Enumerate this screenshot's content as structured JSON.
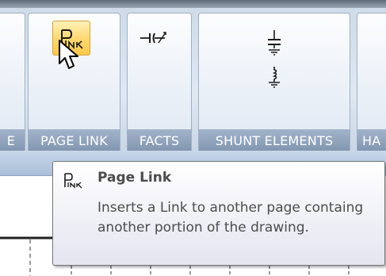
{
  "ribbon": {
    "groups": [
      {
        "id": "prev",
        "label": "E"
      },
      {
        "id": "page_link",
        "label": "PAGE LINK"
      },
      {
        "id": "facts",
        "label": "FACTS"
      },
      {
        "id": "shunt",
        "label": "SHUNT ELEMENTS"
      },
      {
        "id": "next",
        "label": "HA"
      }
    ]
  },
  "tooltip": {
    "title": "Page Link",
    "description": "Inserts a Link to another page containg another portion of the drawing."
  },
  "icons": {
    "page_link": "page-link-icon",
    "facts": "series-capacitor-icon",
    "shunt_1": "shunt-ground-icon",
    "shunt_2": "shunt-inductor-icon",
    "cursor": "mouse-pointer-icon"
  },
  "colors": {
    "ribbon_label_bg": "#8fa3bc",
    "hover_highlight": "#ffd972",
    "tooltip_text": "#4c4c4c"
  }
}
